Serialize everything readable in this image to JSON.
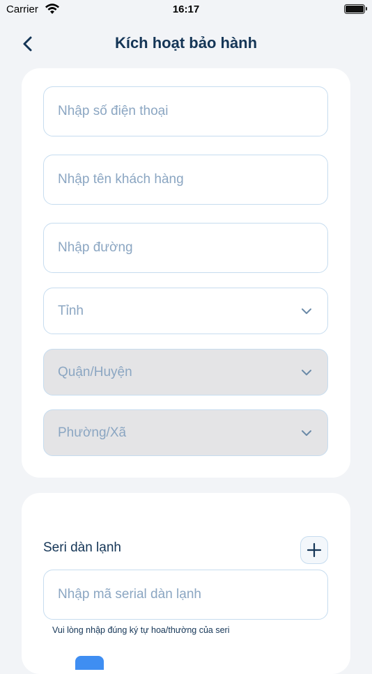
{
  "status_bar": {
    "carrier": "Carrier",
    "time": "16:17"
  },
  "header": {
    "title": "Kích hoạt bảo hành",
    "back_icon": "chevron-left-icon"
  },
  "form": {
    "phone_placeholder": "Nhập số điện thoại",
    "customer_name_placeholder": "Nhập tên khách hàng",
    "street_placeholder": "Nhập đường",
    "province_placeholder": "Tỉnh",
    "district_placeholder": "Quận/Huyện",
    "ward_placeholder": "Phường/Xã"
  },
  "serial": {
    "label": "Seri dàn lạnh",
    "input_placeholder": "Nhập mã serial dàn lạnh",
    "hint": "Vui lòng nhập đúng ký tự hoa/thường của seri",
    "add_icon": "plus-icon"
  },
  "colors": {
    "title": "#143556",
    "placeholder": "#8ba6c2",
    "border": "#c6dcef",
    "disabled_bg": "#e4e4e6",
    "accent": "#3f8ef2"
  }
}
